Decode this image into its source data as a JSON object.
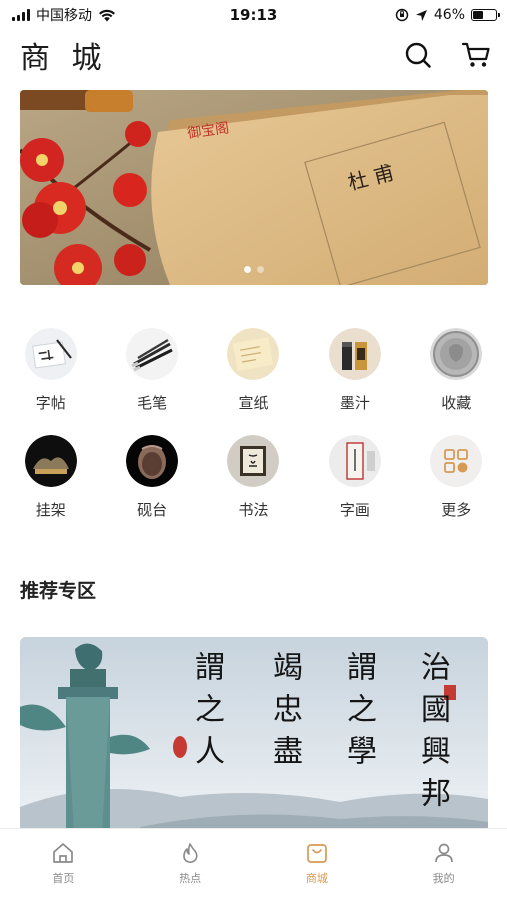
{
  "status_bar": {
    "carrier": "中国移动",
    "time": "19:13",
    "battery": "46%",
    "battery_level": 0.46
  },
  "header": {
    "title": "商 城",
    "search_icon": "search-icon",
    "cart_icon": "cart-icon"
  },
  "banner": {
    "stamp_text": "御宝阁",
    "book_title": "杜 甫",
    "slide_count": 2,
    "active_slide": 1
  },
  "categories": [
    {
      "label": "字帖",
      "icon": "copybook-icon"
    },
    {
      "label": "毛笔",
      "icon": "brush-icon"
    },
    {
      "label": "宣纸",
      "icon": "rice-paper-icon"
    },
    {
      "label": "墨汁",
      "icon": "ink-icon"
    },
    {
      "label": "收藏",
      "icon": "coin-icon"
    },
    {
      "label": "挂架",
      "icon": "stand-icon"
    },
    {
      "label": "砚台",
      "icon": "inkstone-icon"
    },
    {
      "label": "书法",
      "icon": "calligraphy-icon"
    },
    {
      "label": "字画",
      "icon": "painting-icon"
    },
    {
      "label": "更多",
      "icon": "more-icon"
    }
  ],
  "section": {
    "title": "推荐专区"
  },
  "promo": {
    "columns": [
      "治國興邦",
      "謂之學",
      "竭忠盡",
      "謂之人"
    ]
  },
  "tabbar": {
    "items": [
      {
        "label": "首页",
        "icon": "home-icon"
      },
      {
        "label": "热点",
        "icon": "flame-icon"
      },
      {
        "label": "商城",
        "icon": "shop-bag-icon"
      },
      {
        "label": "我的",
        "icon": "user-icon"
      }
    ],
    "active_index": 2
  },
  "colors": {
    "accent": "#d79a55",
    "inactive": "#8a8a8a"
  }
}
